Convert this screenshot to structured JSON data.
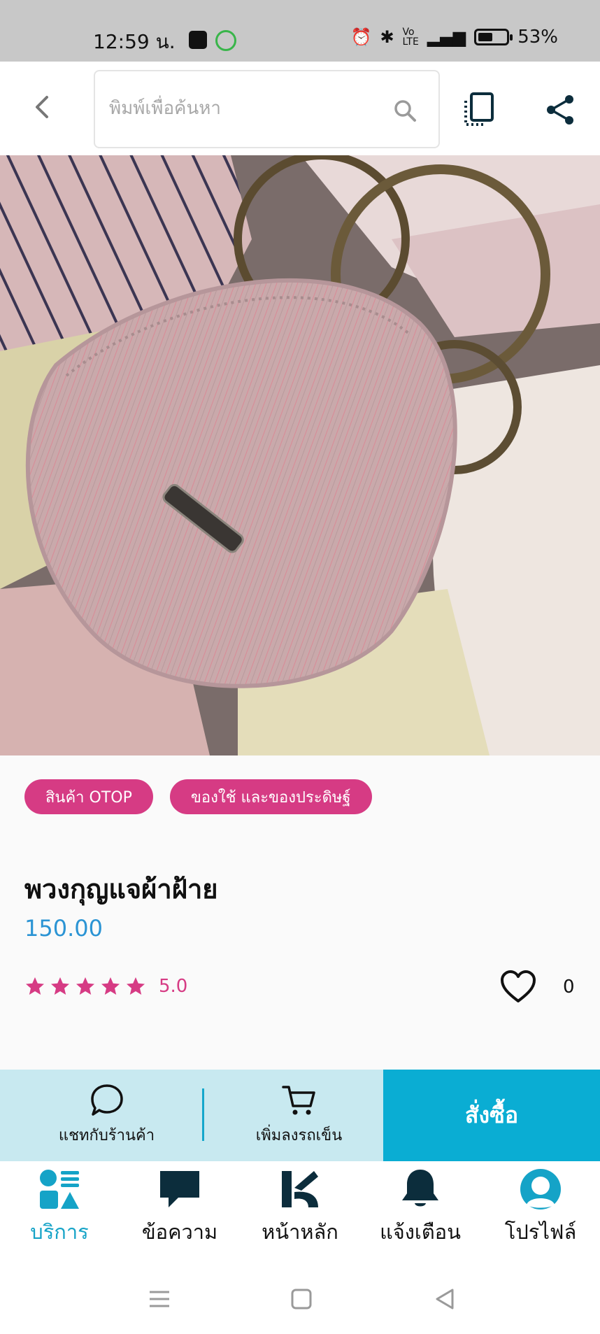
{
  "status_bar": {
    "time": "12:59 น.",
    "battery_level": 0.53,
    "battery_text": "53%"
  },
  "top_bar": {
    "search_placeholder": "พิมพ์เพื่อค้นหา"
  },
  "product": {
    "tags": [
      "สินค้า OTOP",
      "ของใช้ และของประดิษฐ์"
    ],
    "title": "พวงกุญแจผ้าฝ้าย",
    "price": "150.00",
    "rating_stars": 5,
    "rating_value": "5.0",
    "like_count": "0"
  },
  "action_bar": {
    "chat_label": "แชทกับร้านค้า",
    "cart_label": "เพิ่มลงรถเข็น",
    "order_label": "สั่งซื้อ"
  },
  "bottom_nav": {
    "items": [
      {
        "label": "บริการ",
        "icon": "services-icon",
        "active": true
      },
      {
        "label": "ข้อความ",
        "icon": "message-icon",
        "active": false
      },
      {
        "label": "หน้าหลัก",
        "icon": "home-logo-icon",
        "active": false
      },
      {
        "label": "แจ้งเตือน",
        "icon": "bell-icon",
        "active": false
      },
      {
        "label": "โปรไฟล์",
        "icon": "profile-icon",
        "active": false
      }
    ]
  },
  "colors": {
    "accent_pink": "#d63b84",
    "accent_blue": "#0aadd3",
    "price_blue": "#2b94d4",
    "action_bar_bg": "#c8e9f0"
  }
}
